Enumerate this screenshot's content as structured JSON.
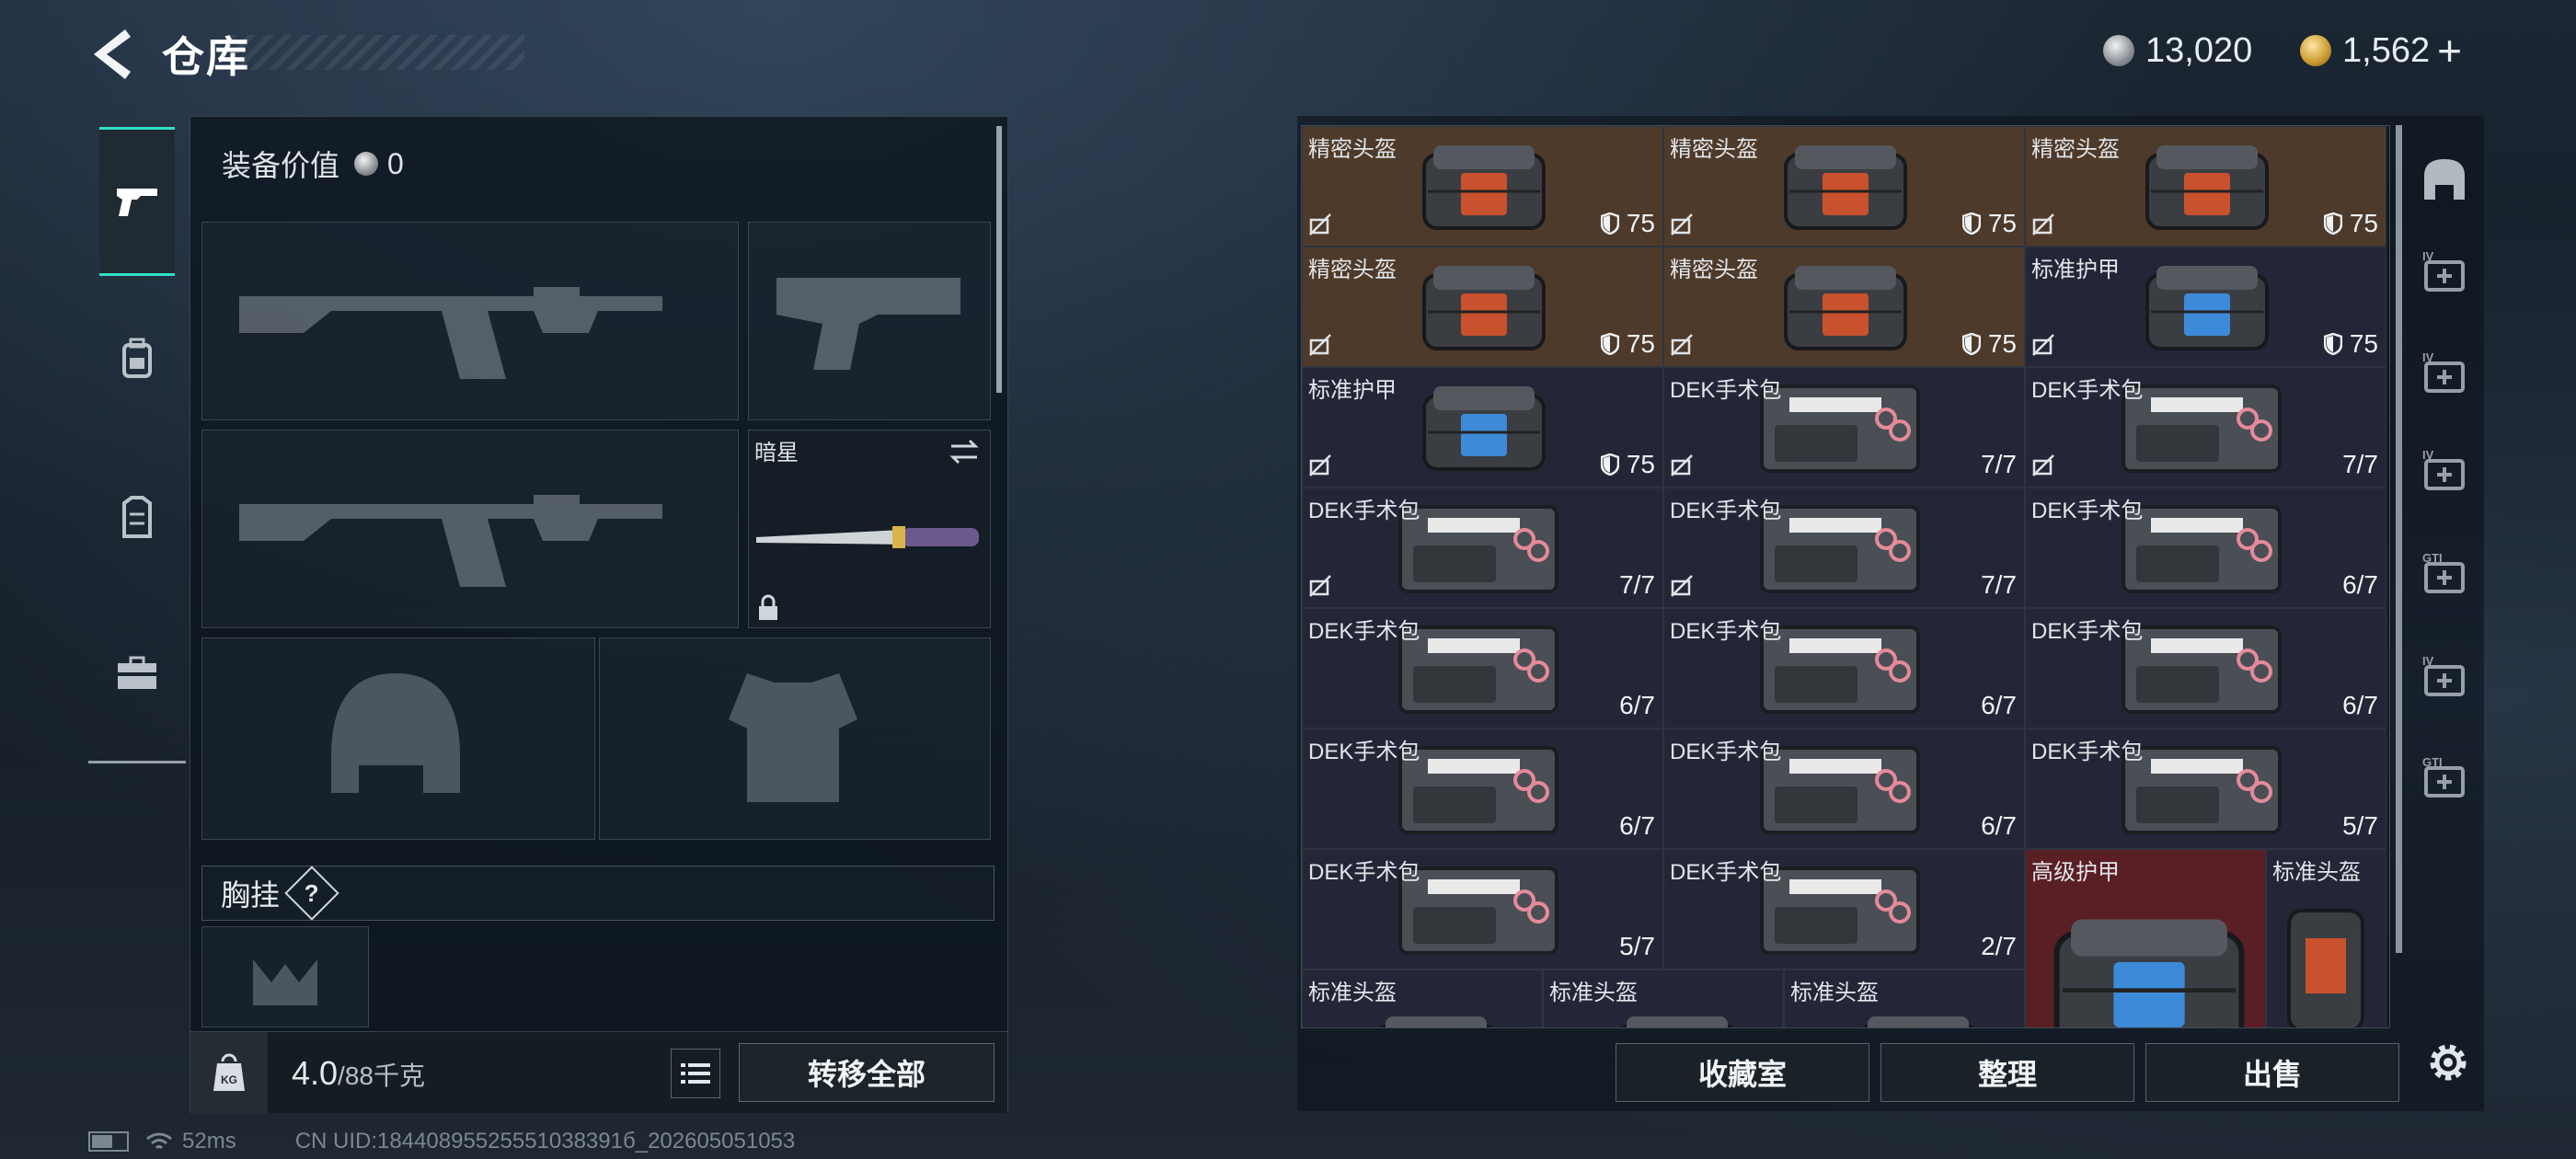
{
  "header": {
    "title": "仓库",
    "back_icon": "back-arrow-icon",
    "currency_silver": "13,020",
    "currency_gold": "1,562",
    "plus_label": "+"
  },
  "left_tabs": [
    {
      "name": "pistol-icon",
      "active": true
    },
    {
      "name": "backpack-icon",
      "active": false
    },
    {
      "name": "vest-icon",
      "active": false
    },
    {
      "name": "briefcase-icon",
      "active": false
    }
  ],
  "loadout": {
    "equip_value_label": "装备价值",
    "equip_value": "0",
    "melee_name": "暗星",
    "chest_rig_label": "胸挂",
    "chest_rig_help": "?",
    "weight_current": "4.0",
    "weight_max": "/88千克",
    "transfer_all": "转移全部"
  },
  "storage": {
    "items": [
      {
        "name": "精密头盔",
        "value": "75",
        "kind": "armor",
        "color": "gold",
        "lock": true
      },
      {
        "name": "精密头盔",
        "value": "75",
        "kind": "armor",
        "color": "gold",
        "lock": true
      },
      {
        "name": "精密头盔",
        "value": "75",
        "kind": "armor",
        "color": "gold",
        "lock": true
      },
      {
        "name": "精密头盔",
        "value": "75",
        "kind": "armor",
        "color": "gold",
        "lock": true
      },
      {
        "name": "精密头盔",
        "value": "75",
        "kind": "armor",
        "color": "gold",
        "lock": true
      },
      {
        "name": "标准护甲",
        "value": "75",
        "kind": "armor",
        "color": "blue",
        "lock": true
      },
      {
        "name": "标准护甲",
        "value": "75",
        "kind": "armor",
        "color": "blue",
        "lock": true
      },
      {
        "name": "DEK手术包",
        "value": "7/7",
        "kind": "kit",
        "color": "blue",
        "lock": true
      },
      {
        "name": "DEK手术包",
        "value": "7/7",
        "kind": "kit",
        "color": "blue",
        "lock": true
      },
      {
        "name": "DEK手术包",
        "value": "7/7",
        "kind": "kit",
        "color": "blue",
        "lock": true
      },
      {
        "name": "DEK手术包",
        "value": "7/7",
        "kind": "kit",
        "color": "blue",
        "lock": true
      },
      {
        "name": "DEK手术包",
        "value": "6/7",
        "kind": "kit",
        "color": "blue",
        "lock": false
      },
      {
        "name": "DEK手术包",
        "value": "6/7",
        "kind": "kit",
        "color": "blue",
        "lock": false
      },
      {
        "name": "DEK手术包",
        "value": "6/7",
        "kind": "kit",
        "color": "blue",
        "lock": false
      },
      {
        "name": "DEK手术包",
        "value": "6/7",
        "kind": "kit",
        "color": "blue",
        "lock": false
      },
      {
        "name": "DEK手术包",
        "value": "6/7",
        "kind": "kit",
        "color": "blue",
        "lock": false
      },
      {
        "name": "DEK手术包",
        "value": "6/7",
        "kind": "kit",
        "color": "blue",
        "lock": false
      },
      {
        "name": "DEK手术包",
        "value": "5/7",
        "kind": "kit",
        "color": "blue",
        "lock": false
      },
      {
        "name": "DEK手术包",
        "value": "5/7",
        "kind": "kit",
        "color": "blue",
        "lock": false
      },
      {
        "name": "DEK手术包",
        "value": "2/7",
        "kind": "kit",
        "color": "blue",
        "lock": false
      }
    ],
    "large_item": {
      "name": "高级护甲"
    },
    "tall_item": {
      "name": "标准头盔"
    },
    "bottom_row": [
      "标准头盔",
      "标准头盔",
      "标准头盔"
    ]
  },
  "right_tabs": [
    "helmet-tab-icon",
    "level-iv-case-icon",
    "level-iv-medkit-icon",
    "level-iv-medkit-add-icon",
    "gti-armor-icon",
    "level-iv-armor-icon",
    "gti-rig-icon"
  ],
  "actions": {
    "collection": "收藏室",
    "sort": "整理",
    "sell": "出售"
  },
  "status": {
    "ping": "52ms",
    "uid": "CN UID:18440895525551038391б_202605051053"
  },
  "colors": {
    "accent": "#2fe0c8",
    "gold_rarity": "#4e3a2a",
    "blue_rarity": "#242638",
    "red_rarity": "#5a1f25"
  }
}
